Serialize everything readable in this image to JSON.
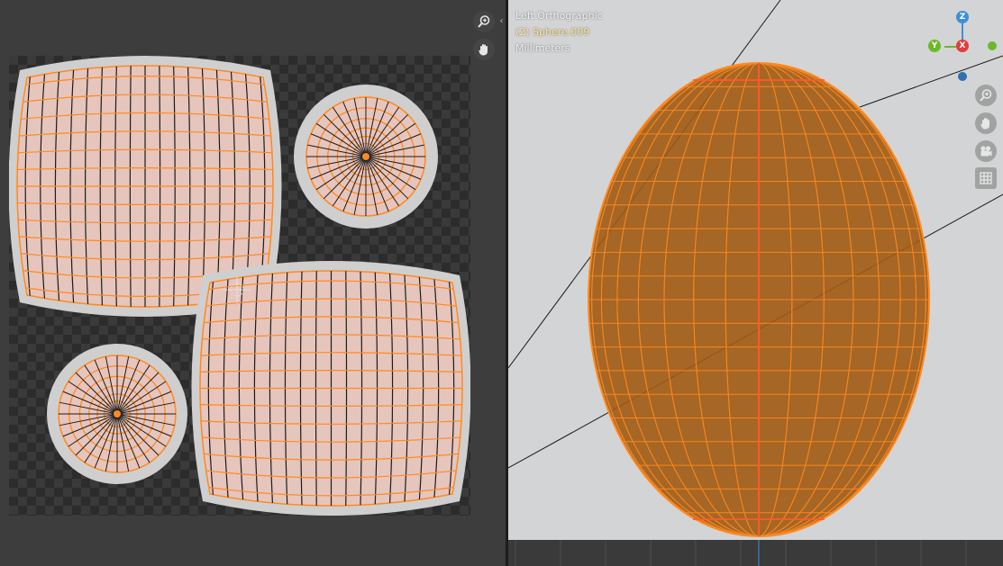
{
  "uv_editor": {
    "collapse_glyph": "‹",
    "tools": [
      {
        "icon": "zoom-icon"
      },
      {
        "icon": "pan-hand-icon"
      }
    ]
  },
  "viewport": {
    "view_name": "Left Orthographic",
    "object_label": "(2) Sphere.009",
    "units": "Millimeters",
    "gizmo": {
      "z_label": "Z",
      "y_label": "Y",
      "x_label": "X"
    },
    "nav_buttons": [
      {
        "icon": "zoom-icon"
      },
      {
        "icon": "pan-hand-icon"
      },
      {
        "icon": "camera-icon"
      },
      {
        "icon": "grid-icon"
      }
    ]
  },
  "colors": {
    "wire": "#ff8a1f",
    "uv_fill": "#e6c5bd",
    "uv_margin": "#cfcfcf",
    "mesh_fill": "#a15a12",
    "axis_x": "#e23c3c",
    "axis_y": "#6db82a",
    "axis_z": "#3d8fd8",
    "header_label": "#ffe08a"
  }
}
